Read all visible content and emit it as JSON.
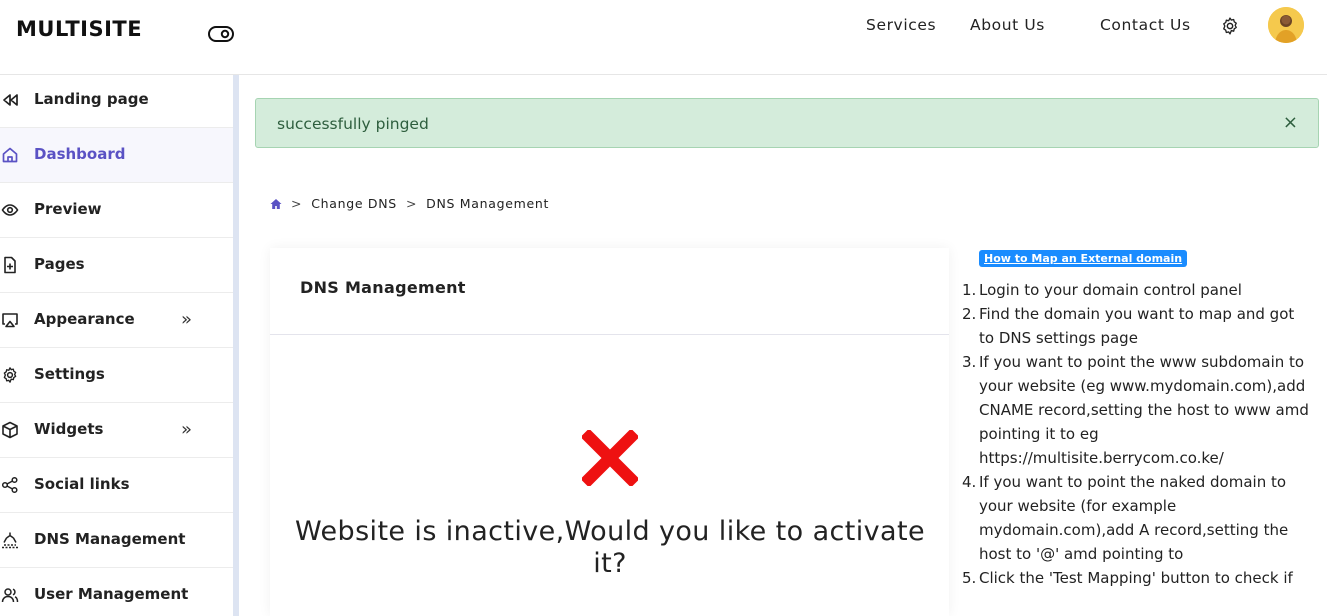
{
  "header": {
    "brand": "MULTISITE",
    "nav": [
      "Services",
      "About Us",
      "Contact Us"
    ]
  },
  "sidebar": {
    "items": [
      {
        "label": "Landing page",
        "icon": "rewind-icon"
      },
      {
        "label": "Dashboard",
        "icon": "home-icon",
        "active": true
      },
      {
        "label": "Preview",
        "icon": "eye-icon"
      },
      {
        "label": "Pages",
        "icon": "file-plus-icon"
      },
      {
        "label": "Appearance",
        "icon": "monitor-icon",
        "chevron": "»"
      },
      {
        "label": "Settings",
        "icon": "gear-icon"
      },
      {
        "label": "Widgets",
        "icon": "box-icon",
        "chevron": "»"
      },
      {
        "label": "Social links",
        "icon": "share-icon"
      },
      {
        "label": "DNS Management",
        "icon": "network-icon"
      },
      {
        "label": "User Management",
        "icon": "users-icon"
      }
    ]
  },
  "alert": {
    "message": "successfully pinged",
    "close": "×"
  },
  "breadcrumb": {
    "items": [
      "Change DNS",
      "DNS Management"
    ],
    "separator": ">"
  },
  "card": {
    "title": "DNS Management",
    "message": "Website is inactive,Would you like to activate it?"
  },
  "help": {
    "link": "How to Map an External domain",
    "steps": [
      "Login to your domain control panel",
      "Find the domain you want to map and got to DNS settings page",
      "If you want to point the www subdomain to your website (eg www.mydomain.com),add CNAME record,setting the host to www amd pointing it to eg https://multisite.berrycom.co.ke/",
      "If you want to point the naked domain to your website (for example mydomain.com),add A record,setting the host to '@' amd pointing to",
      "Click the 'Test Mapping' button to check if"
    ]
  },
  "colors": {
    "accent": "#5a52c4",
    "alert_bg": "#d4ecdb",
    "alert_text": "#2e5e3e",
    "error": "#ee1111",
    "link_bg": "#1a8cff"
  }
}
